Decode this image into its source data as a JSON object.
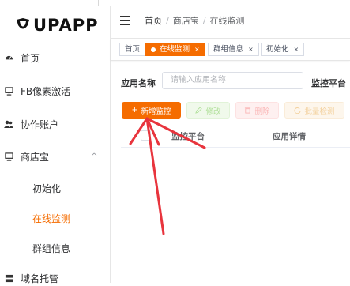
{
  "app": {
    "logo_text": "UPAPP"
  },
  "sidebar": {
    "items": [
      {
        "label": "首页",
        "icon": "dashboard-icon"
      },
      {
        "label": "FB像素激活",
        "icon": "monitor-icon"
      },
      {
        "label": "协作账户",
        "icon": "users-icon"
      },
      {
        "label": "商店宝",
        "icon": "monitor-icon",
        "arrow": "^"
      },
      {
        "label": "域名托管",
        "icon": "server-icon"
      }
    ],
    "submenu": [
      {
        "label": "初始化"
      },
      {
        "label": "在线监测"
      },
      {
        "label": "群组信息"
      }
    ]
  },
  "header": {
    "breadcrumb": [
      "首页",
      "商店宝",
      "在线监测"
    ],
    "separator": "/"
  },
  "tags": [
    {
      "label": "首页"
    },
    {
      "label": "在线监测"
    },
    {
      "label": "群组信息"
    },
    {
      "label": "初始化"
    }
  ],
  "tag_close": "×",
  "form": {
    "app_name_label": "应用名称",
    "app_name_placeholder": "请输入应用名称",
    "platform_label": "监控平台"
  },
  "toolbar": {
    "add_label": "新增监控",
    "add_icon": "+",
    "edit_label": "修改",
    "delete_label": "删除",
    "batch_label": "批量检测"
  },
  "table": {
    "columns": [
      "监控平台",
      "应用详情"
    ]
  },
  "colors": {
    "accent": "#f56c00",
    "annotation_arrow": "#e8343d"
  }
}
